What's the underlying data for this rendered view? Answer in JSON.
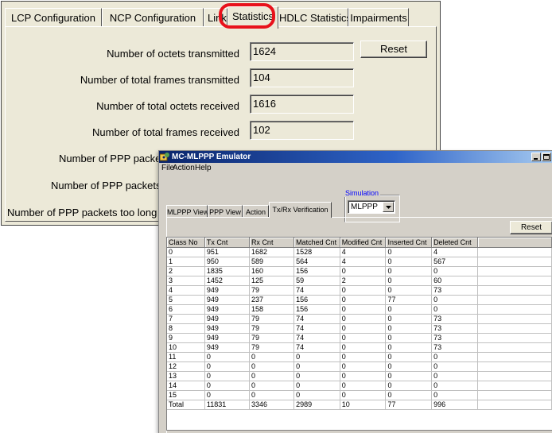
{
  "stats_window": {
    "tabs": [
      "LCP Configuration",
      "NCP Configuration",
      "Link Tes",
      "Statistics",
      "HDLC Statistics",
      "Impairments"
    ],
    "active_tab": "Statistics",
    "highlight_color": "#e8111b",
    "rows": [
      {
        "label": "Number of octets transmitted",
        "value": "1624"
      },
      {
        "label": "Number of total frames transmitted",
        "value": "104"
      },
      {
        "label": "Number of total octets received",
        "value": "1616"
      },
      {
        "label": "Number of total frames received",
        "value": "102"
      },
      {
        "label": "Number of PPP packet",
        "value": ""
      },
      {
        "label": "Number of PPP packets w",
        "value": ""
      },
      {
        "label": "Number of PPP packets too long",
        "value": ""
      }
    ],
    "reset_label": "Reset"
  },
  "emulator_window": {
    "title": "MC-MLPPP Emulator",
    "titlebar_color": "#0a246a",
    "menu": [
      "File",
      "Action",
      "Help"
    ],
    "simulation": {
      "label": "Simulation",
      "value": "MLPPP"
    },
    "tabs": [
      "MLPPP View",
      "PPP View",
      "Action",
      "Tx/Rx Verification"
    ],
    "active_tab": "Tx/Rx Verification",
    "reset_label": "Reset",
    "table": {
      "columns": [
        "Class No",
        "Tx Cnt",
        "Rx Cnt",
        "Matched Cnt",
        "Modified Cnt",
        "Inserted Cnt",
        "Deleted Cnt",
        ""
      ],
      "rows": [
        [
          "0",
          "951",
          "1682",
          "1528",
          "4",
          "0",
          "4"
        ],
        [
          "1",
          "950",
          "589",
          "564",
          "4",
          "0",
          "567"
        ],
        [
          "2",
          "1835",
          "160",
          "156",
          "0",
          "0",
          "0"
        ],
        [
          "3",
          "1452",
          "125",
          "59",
          "2",
          "0",
          "60"
        ],
        [
          "4",
          "949",
          "79",
          "74",
          "0",
          "0",
          "73"
        ],
        [
          "5",
          "949",
          "237",
          "156",
          "0",
          "77",
          "0"
        ],
        [
          "6",
          "949",
          "158",
          "156",
          "0",
          "0",
          "0"
        ],
        [
          "7",
          "949",
          "79",
          "74",
          "0",
          "0",
          "73"
        ],
        [
          "8",
          "949",
          "79",
          "74",
          "0",
          "0",
          "73"
        ],
        [
          "9",
          "949",
          "79",
          "74",
          "0",
          "0",
          "73"
        ],
        [
          "10",
          "949",
          "79",
          "74",
          "0",
          "0",
          "73"
        ],
        [
          "11",
          "0",
          "0",
          "0",
          "0",
          "0",
          "0"
        ],
        [
          "12",
          "0",
          "0",
          "0",
          "0",
          "0",
          "0"
        ],
        [
          "13",
          "0",
          "0",
          "0",
          "0",
          "0",
          "0"
        ],
        [
          "14",
          "0",
          "0",
          "0",
          "0",
          "0",
          "0"
        ],
        [
          "15",
          "0",
          "0",
          "0",
          "0",
          "0",
          "0"
        ],
        [
          "Total",
          "11831",
          "3346",
          "2989",
          "10",
          "77",
          "996"
        ]
      ]
    }
  }
}
